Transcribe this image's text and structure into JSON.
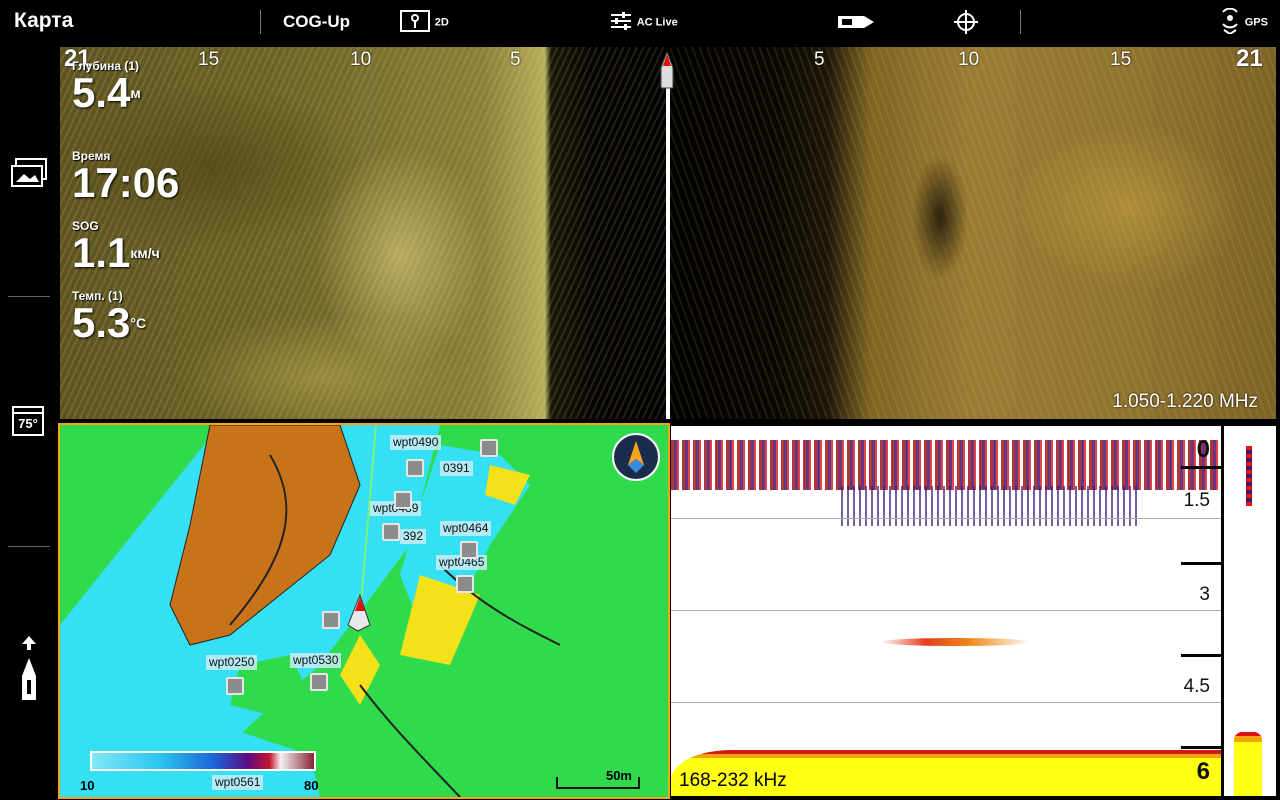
{
  "topbar": {
    "title": "Карта",
    "orientation": "COG-Up",
    "view_mode": "2D",
    "ac_live": "AC Live",
    "gps": "GPS"
  },
  "sidebar": {
    "temp_icon_text": "75°"
  },
  "side_imaging": {
    "range_labels_left": [
      "21",
      "15",
      "10",
      "5"
    ],
    "range_labels_right": [
      "5",
      "10",
      "15",
      "21"
    ],
    "frequency": "1.050-1.220 MHz"
  },
  "data_fields": [
    {
      "label": "Глубина (1)",
      "value": "5.4",
      "unit": "м"
    },
    {
      "label": "Время",
      "value": "17:06",
      "unit": ""
    },
    {
      "label": "SOG",
      "value": "1.1",
      "unit": "км/ч"
    },
    {
      "label": "Темп. (1)",
      "value": "5.3",
      "unit": "°C"
    }
  ],
  "chart": {
    "waypoints": [
      {
        "name": "wpt0490"
      },
      {
        "name": "0391"
      },
      {
        "name": "wpt0489"
      },
      {
        "name": "wpt0464"
      },
      {
        "name": "392"
      },
      {
        "name": "wpt0465"
      },
      {
        "name": "wpt0530"
      },
      {
        "name": "wpt0250"
      },
      {
        "name": "wpt0561"
      }
    ],
    "scale_label": "50m",
    "legend_min": "10",
    "legend_max": "80"
  },
  "sonar": {
    "depth_labels": [
      "0",
      "1.5",
      "3",
      "4.5",
      "6"
    ],
    "frequency": "168-232 kHz"
  }
}
